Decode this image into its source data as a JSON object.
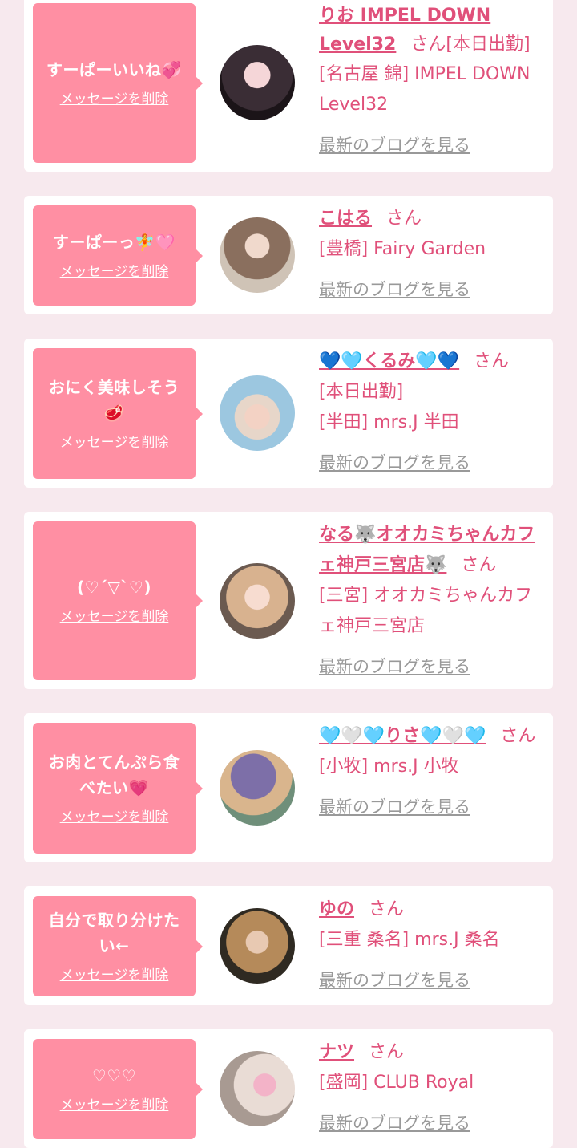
{
  "delete_label": "メッセージを削除",
  "blog_label": "最新のブログを見る",
  "san": "さん",
  "cards": [
    {
      "message": "すーぱーいいね💞",
      "name": "りお IMPEL DOWN Level32",
      "status": "[本日出勤]",
      "shop": "[名古屋 錦] IMPEL DOWN Level32",
      "avatar_color": "#3a2d35"
    },
    {
      "message": "すーぱーっ🧚🩷",
      "name": "こはる",
      "status": "",
      "shop": "[豊橋] Fairy Garden",
      "avatar_color": "#b9a99a"
    },
    {
      "message": "おにく美味しそう🥩",
      "name": "💙🩵くるみ🩵💙",
      "status": "[本日出勤]",
      "shop": "[半田] mrs.J 半田",
      "avatar_color": "#9cc7e0"
    },
    {
      "message": "(♡ˊ▽ˋ♡)",
      "name": "なる🐺オオカミちゃんカフェ神戸三宮店🐺",
      "status": "",
      "shop": "[三宮] オオカミちゃんカフェ神戸三宮店",
      "avatar_color": "#d8b28f"
    },
    {
      "message": "お肉とてんぷら食べたい💗",
      "name": "🩵🤍🩵りさ🩵🤍🩵",
      "status": "",
      "shop": "[小牧] mrs.J 小牧",
      "avatar_color": "#7d6fa8"
    },
    {
      "message": "自分で取り分けたい←",
      "name": "ゆの",
      "status": "",
      "shop": "[三重 桑名] mrs.J 桑名",
      "avatar_color": "#6e5a3f"
    },
    {
      "message": "♡♡♡",
      "name": "ナツ",
      "status": "",
      "shop": "[盛岡] CLUB Royal",
      "avatar_color": "#c7bcb5"
    }
  ]
}
